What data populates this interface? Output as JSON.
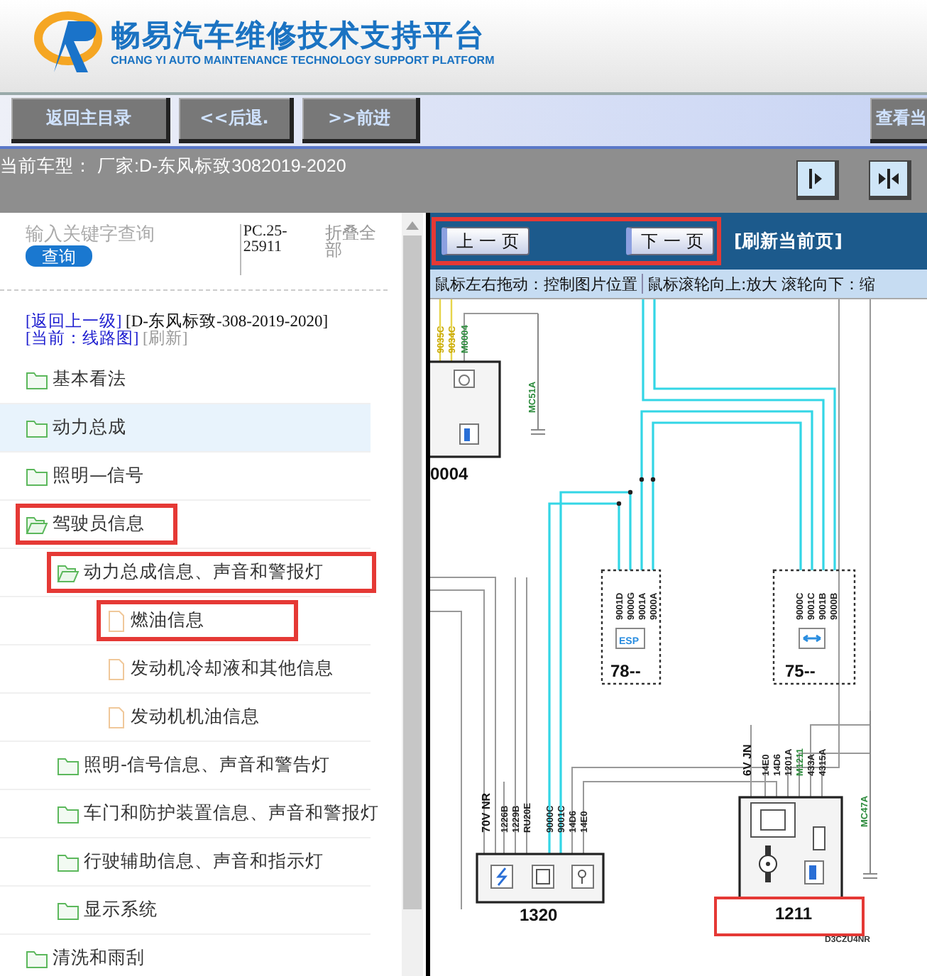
{
  "header": {
    "title": "畅易汽车维修技术支持平台",
    "subtitle": "CHANG YI AUTO MAINTENANCE TECHNOLOGY SUPPORT PLATFORM"
  },
  "toolbar": {
    "buttons": [
      "返回主目录",
      "<<后退.",
      ">>前进"
    ],
    "right_button": "查看当"
  },
  "vehicle_bar": {
    "text": "当前车型：  厂家:D-东风标致3082019-2020"
  },
  "sidebar": {
    "search": {
      "placeholder": "输入关键字查询",
      "button": "查询"
    },
    "code": "PC.25-25911",
    "collapse": "折叠全部",
    "breadcrumb": {
      "back": "[返回上一级]",
      "model": "[D-东风标致-308-2019-2020]",
      "current": "[当前：线路图]",
      "refresh": "[刷新]"
    },
    "tree": [
      {
        "label": "基本看法",
        "kind": "folder",
        "expanded": false,
        "shaded": false,
        "highlighted": false
      },
      {
        "label": "动力总成",
        "kind": "folder",
        "expanded": false,
        "shaded": true,
        "highlighted": false
      },
      {
        "label": "照明—信号",
        "kind": "folder",
        "expanded": false,
        "shaded": false,
        "highlighted": false
      },
      {
        "label": "驾驶员信息",
        "kind": "folder",
        "expanded": true,
        "shaded": false,
        "highlighted": true,
        "children": [
          {
            "label": "动力总成信息、声音和警报灯",
            "kind": "folder",
            "expanded": true,
            "shaded": false,
            "highlighted": true,
            "children": [
              {
                "label": "燃油信息",
                "kind": "file",
                "expanded": false,
                "shaded": false,
                "highlighted": true
              },
              {
                "label": "发动机冷却液和其他信息",
                "kind": "file",
                "expanded": false,
                "shaded": false,
                "highlighted": false
              },
              {
                "label": "发动机机油信息",
                "kind": "file",
                "expanded": false,
                "shaded": false,
                "highlighted": false
              }
            ]
          },
          {
            "label": "照明-信号信息、声音和警告灯",
            "kind": "folder",
            "expanded": false,
            "shaded": false,
            "highlighted": false
          },
          {
            "label": "车门和防护装置信息、声音和警报灯",
            "kind": "folder",
            "expanded": false,
            "shaded": false,
            "highlighted": false
          },
          {
            "label": "行驶辅助信息、声音和指示灯",
            "kind": "folder",
            "expanded": false,
            "shaded": false,
            "highlighted": false
          },
          {
            "label": "显示系统",
            "kind": "folder",
            "expanded": false,
            "shaded": false,
            "highlighted": false
          }
        ]
      },
      {
        "label": "清洗和雨刮",
        "kind": "folder",
        "expanded": false,
        "shaded": false,
        "highlighted": false
      }
    ]
  },
  "viewer": {
    "pager": {
      "prev": "上 一 页",
      "next": "下 一 页",
      "highlighted": true
    },
    "refresh": "[刷新当前页]",
    "hints": [
      "鼠标左右拖动：控制图片位置",
      "鼠标滚轮向上:放大",
      "滚轮向下：缩"
    ],
    "diagram": {
      "components": [
        {
          "label": "0004",
          "wires": [
            "9035C",
            "9034C",
            "M0004"
          ],
          "highlighted": false
        },
        {
          "label": "78--",
          "badge": "ESP",
          "wires": [
            "9001D",
            "9000G",
            "9001A",
            "9000A"
          ],
          "highlighted": false
        },
        {
          "label": "75--",
          "wires": [
            "9000C",
            "9001C",
            "9001B",
            "9000B"
          ],
          "highlighted": false
        },
        {
          "label": "1320",
          "connector": "70V NR",
          "wires": [
            "1226B",
            "1229B",
            "RU20E",
            "9000C",
            "9001C",
            "14D6",
            "14E0"
          ],
          "highlighted": false
        },
        {
          "label": "1211",
          "connector": "6V JN",
          "wires": [
            "14E0",
            "14D6",
            "1201A",
            "M1211",
            "433A",
            "4315A"
          ],
          "highlighted": true
        }
      ],
      "grounds": [
        "MC51A",
        "MC47A"
      ],
      "code": "D3CZU4NR"
    }
  }
}
